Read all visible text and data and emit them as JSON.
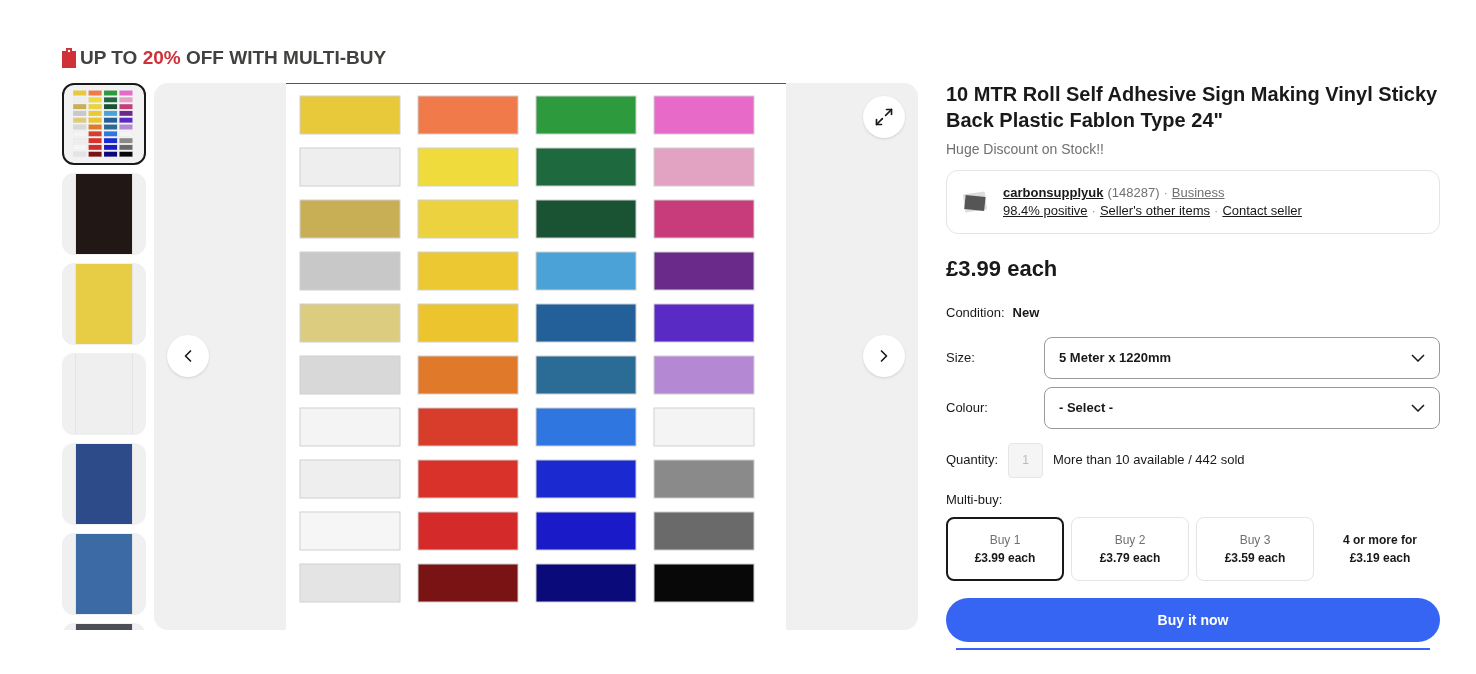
{
  "promo": {
    "text": "UP TO **20%** OFF WITH MULTI-BUY"
  },
  "thumbnails": [
    {
      "kind": "chart",
      "color": "#f2f2f2",
      "selected": true
    },
    {
      "kind": "swatch",
      "color": "#211816",
      "selected": false
    },
    {
      "kind": "swatch",
      "color": "#e6cd45",
      "selected": false
    },
    {
      "kind": "swatch",
      "color": "#efefef",
      "selected": false
    },
    {
      "kind": "swatch",
      "color": "#2c4b88",
      "selected": false
    },
    {
      "kind": "swatch",
      "color": "#3b6aa4",
      "selected": false
    },
    {
      "kind": "swatch",
      "color": "#4a4f57",
      "selected": false
    }
  ],
  "product": {
    "title": "10 MTR Roll Self Adhesive Sign Making Vinyl Sticky Back Plastic Fablon Type 24\"",
    "subtitle": "Huge Discount on Stock!!"
  },
  "seller": {
    "name": "carbonsupplyuk",
    "count": "(148287)",
    "type": "Business",
    "separator": "·",
    "links": [
      "98.4% positive",
      "Seller's other items",
      "Contact seller"
    ]
  },
  "price": "£3.99 each",
  "condition": {
    "label": "Condition:",
    "value": "New"
  },
  "selects": [
    {
      "label": "Size:",
      "value": "5 Meter x 1220mm"
    },
    {
      "label": "Colour:",
      "value": "- Select -"
    }
  ],
  "quantity": {
    "label": "Quantity:",
    "placeholder": "1",
    "note": "More than 10 available / 442 sold"
  },
  "multibuy": {
    "label": "Multi-buy:",
    "options": [
      {
        "kind": "box",
        "qty": "Buy 1",
        "price": "£3.99 each",
        "selected": true
      },
      {
        "kind": "box",
        "qty": "Buy 2",
        "price": "£3.79 each",
        "selected": false
      },
      {
        "kind": "box",
        "qty": "Buy 3",
        "price": "£3.59 each",
        "selected": false
      },
      {
        "kind": "plain",
        "qty": "4 or more for",
        "price": "£3.19 each",
        "selected": false
      }
    ]
  },
  "buy_button": "Buy it now"
}
